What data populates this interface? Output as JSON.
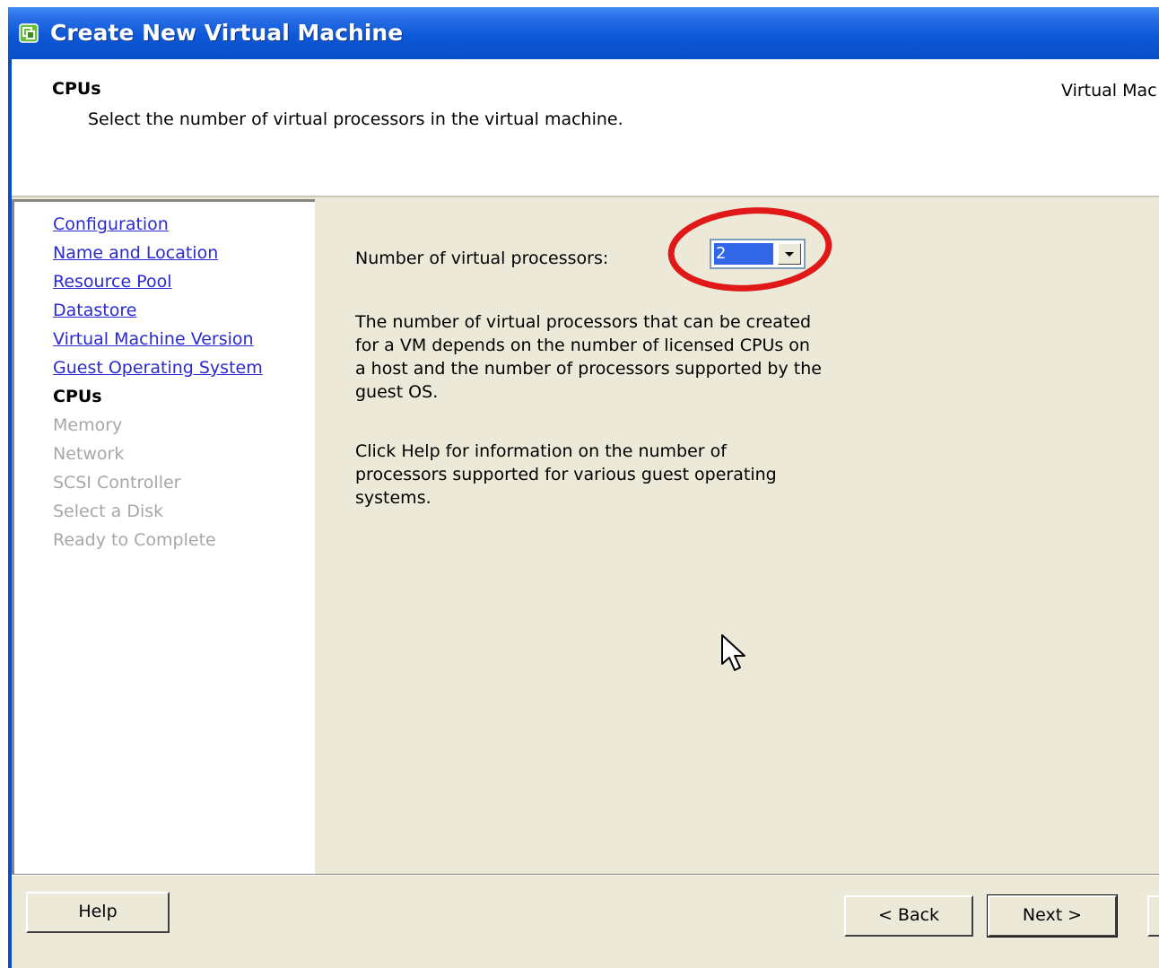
{
  "window": {
    "title": "Create New Virtual Machine"
  },
  "header": {
    "title": "CPUs",
    "subtitle": "Select the number of virtual processors in the virtual machine.",
    "right_text": "Virtual Mac"
  },
  "nav": {
    "completed": [
      "Configuration",
      "Name and Location",
      "Resource Pool",
      "Datastore",
      "Virtual Machine Version",
      "Guest Operating System"
    ],
    "current": "CPUs",
    "upcoming": [
      "Memory",
      "Network",
      "SCSI Controller",
      "Select a Disk",
      "Ready to Complete"
    ]
  },
  "main": {
    "processors_label": "Number of virtual processors:",
    "processors_value": "2",
    "paragraph1": "The number of virtual processors that can be created for a VM depends on the number of licensed CPUs on a host and the number of processors supported by the guest OS.",
    "paragraph2": "Click Help for information on the number of processors supported for various guest operating systems."
  },
  "footer": {
    "help_label": "Help",
    "back_label": "< Back",
    "next_label": "Next >"
  },
  "colors": {
    "titlebar": "#0a4fc8",
    "link": "#2a2ad0",
    "annotation": "#e01818",
    "selection": "#3166e8"
  }
}
